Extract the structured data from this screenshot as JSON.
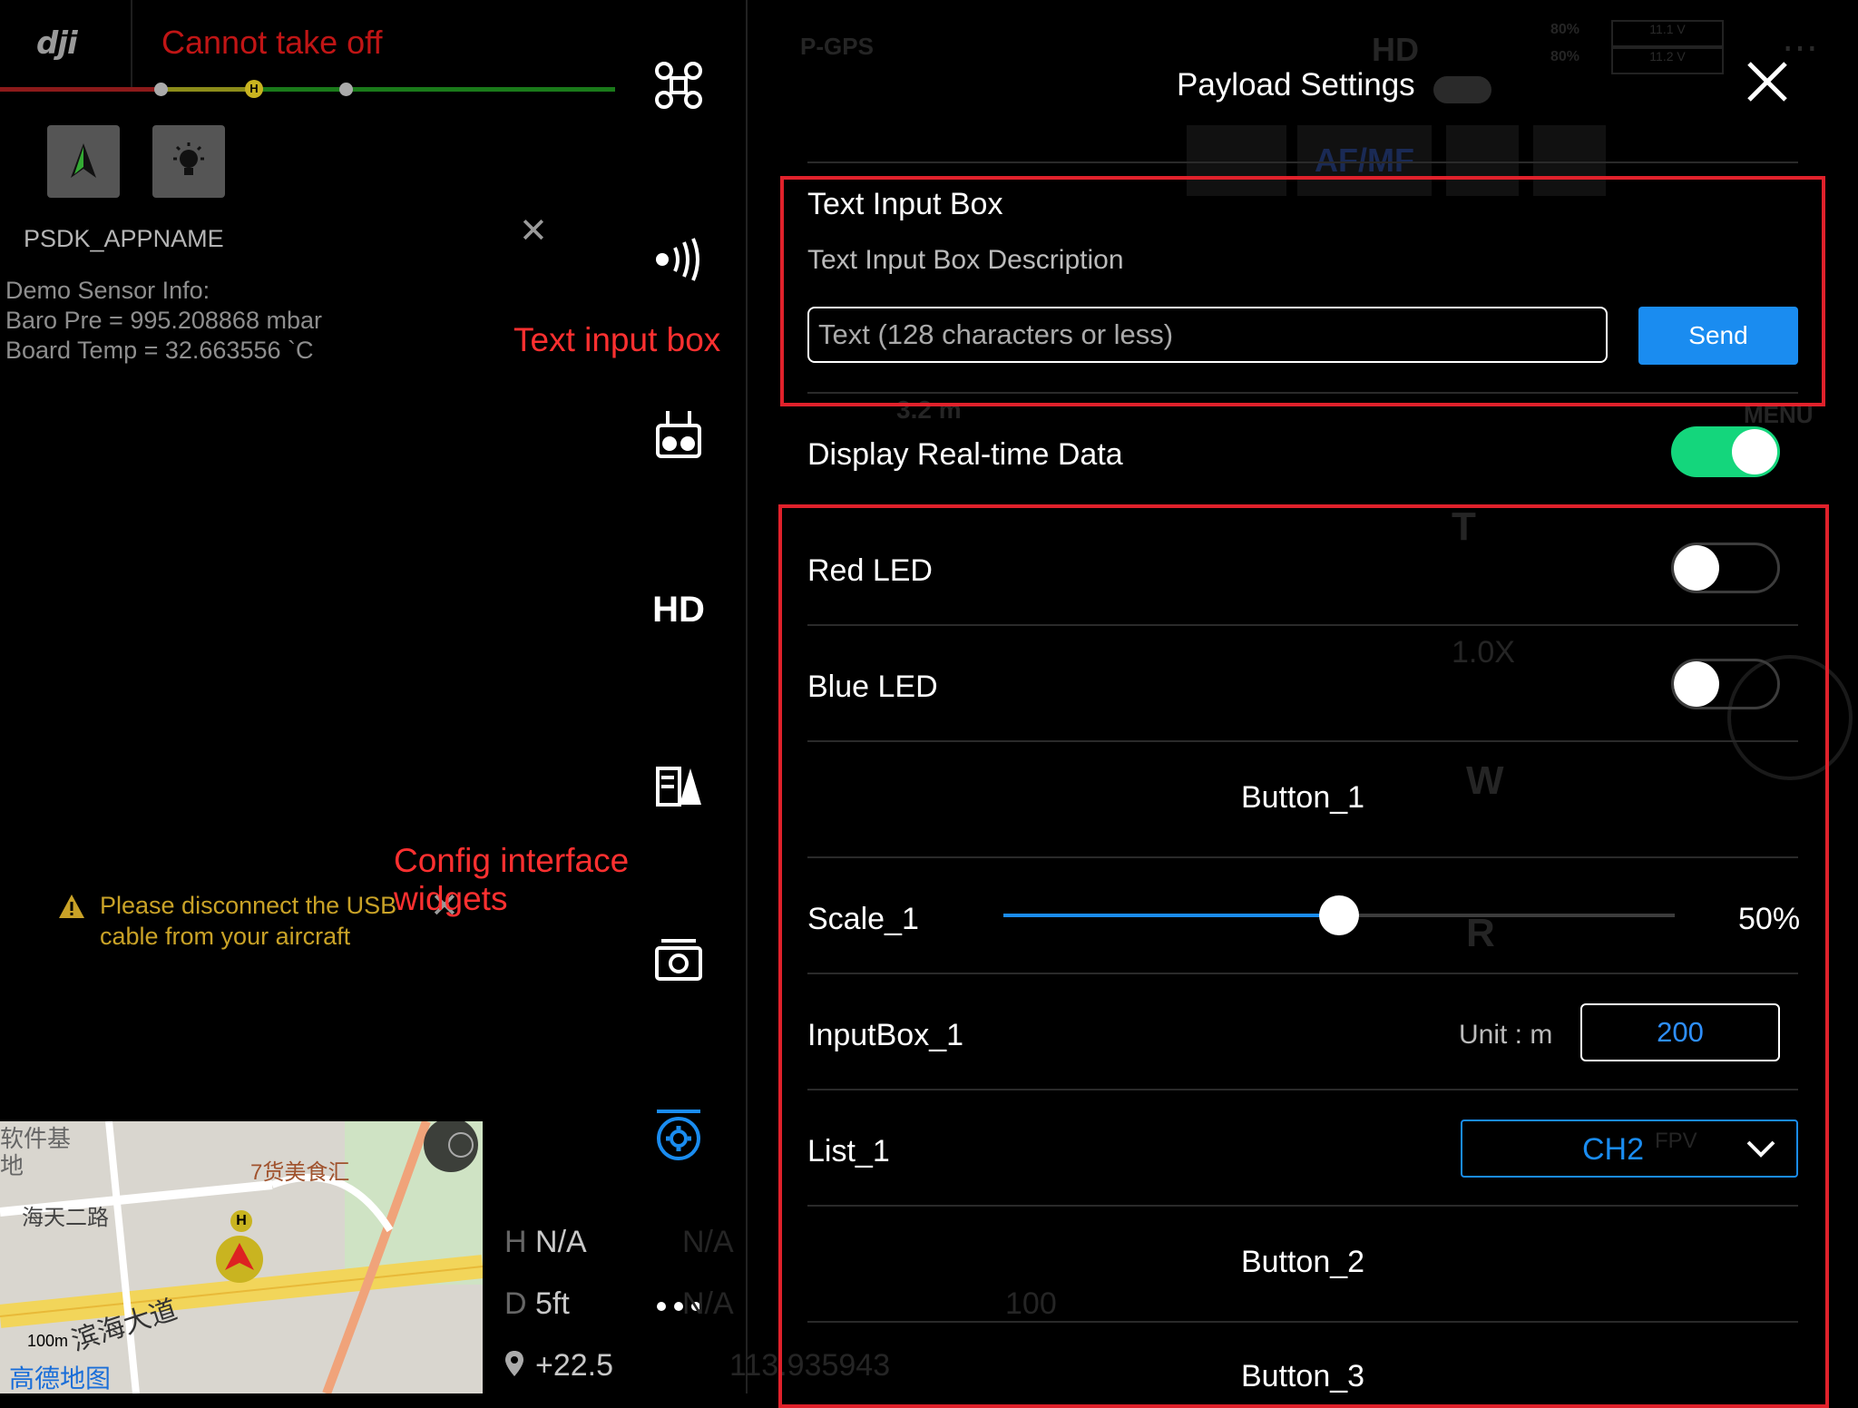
{
  "app": {
    "logo_text": "dji",
    "takeoff_status": "Cannot take off",
    "status_line_node_label": "H"
  },
  "left": {
    "app_name": "PSDK_APPNAME",
    "sensor_info": "Demo Sensor Info:\nBaro Pre = 995.208868 mbar\nBoard Temp = 32.663556 `C",
    "warning_text": "Please disconnect the USB cable from your aircraft"
  },
  "annotations": {
    "text_input_box": "Text input box",
    "config_widgets": "Config interface widgets"
  },
  "map": {
    "labels": [
      "软件基地",
      "7货美食汇",
      "海天二路",
      "滨海大道",
      "H"
    ],
    "scale": "100m",
    "brand": "高德地图"
  },
  "hud": {
    "h_label": "H",
    "h_value": "N/A",
    "d_label": "D",
    "d_value": "5ft",
    "coord_partial": "+22.5",
    "ghost_values": [
      "N/A",
      "N/A",
      "100",
      "113.935943"
    ]
  },
  "rail": {
    "hd_label": "HD",
    "icons": [
      "aircraft-icon",
      "signal-icon",
      "remote-controller-icon",
      "hd-icon",
      "battery-icon",
      "camera-icon",
      "settings-icon",
      "more-icon"
    ]
  },
  "topbar_ghost": {
    "gps": "P-GPS",
    "hd": "HD",
    "battery_1": "80%",
    "battery_2": "80%",
    "volt_1": "11.1 V",
    "volt_2": "11.2 V",
    "af_mf": "AF/MF",
    "altitude": "3.2 m",
    "menu": "MENU",
    "zoom": "1.0X",
    "t": "T",
    "w": "W",
    "r": "R",
    "fpv": "FPV"
  },
  "panel": {
    "title": "Payload Settings",
    "text_input": {
      "label": "Text Input Box",
      "description": "Text Input Box Description",
      "placeholder": "Text (128 characters or less)",
      "send_label": "Send"
    },
    "display_realtime": {
      "label": "Display Real-time Data",
      "on": true
    },
    "red_led": {
      "label": "Red LED",
      "on": false
    },
    "blue_led": {
      "label": "Blue LED",
      "on": false
    },
    "button_1": "Button_1",
    "scale_1": {
      "label": "Scale_1",
      "value_text": "50%",
      "value": 0.5
    },
    "input_box_1": {
      "label": "InputBox_1",
      "unit": "Unit : m",
      "value": "200"
    },
    "list_1": {
      "label": "List_1",
      "selected": "CH2"
    },
    "button_2": "Button_2",
    "button_3": "Button_3"
  },
  "colors": {
    "accent_blue": "#1a8cf0",
    "toggle_on": "#14d67c",
    "annotation_red": "#ff3030",
    "warning_yellow": "#c9a227"
  }
}
